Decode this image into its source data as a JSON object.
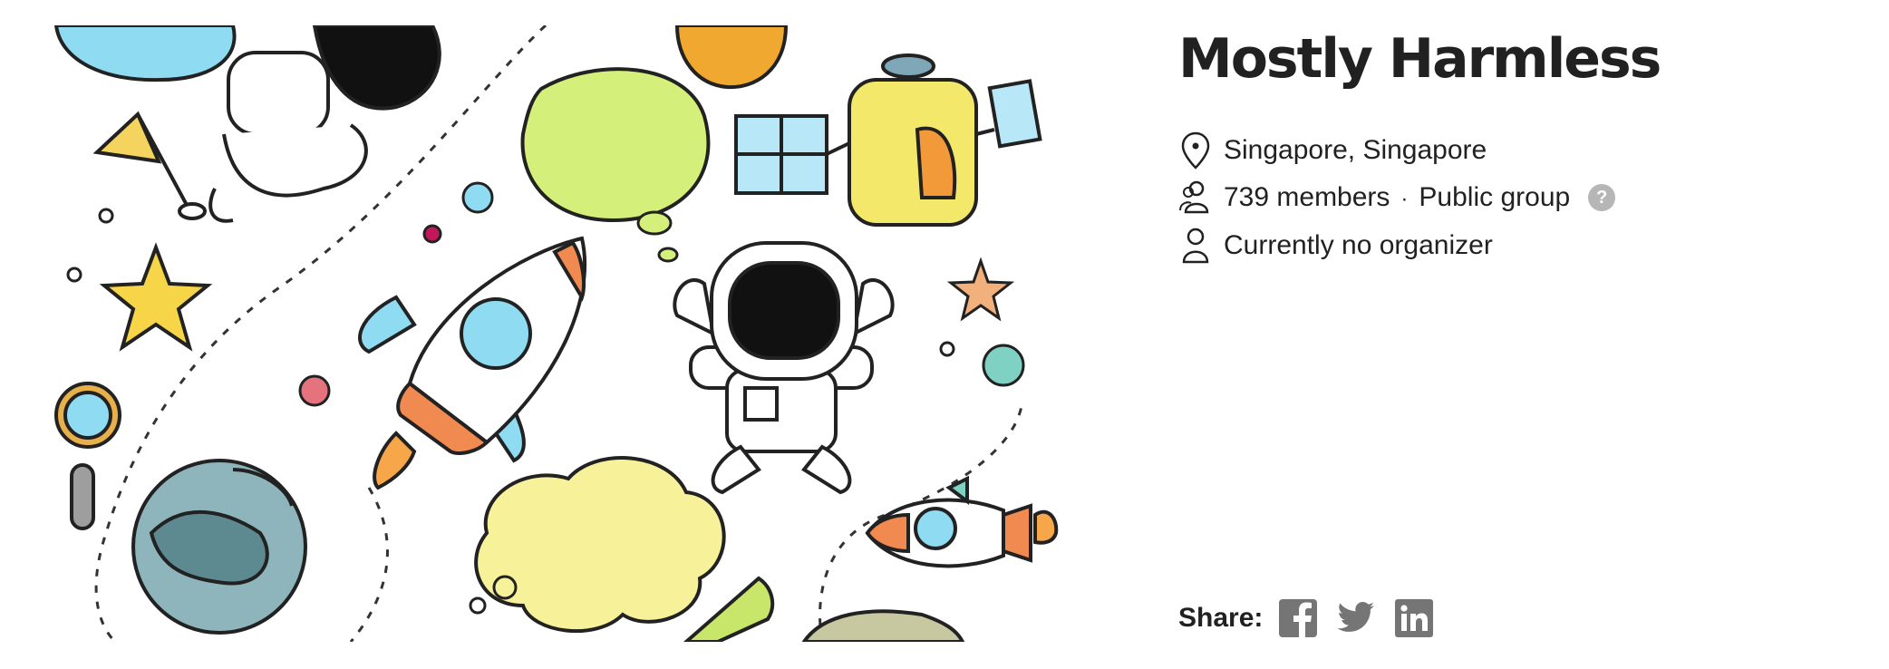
{
  "group": {
    "name": "Mostly Harmless",
    "location": "Singapore, Singapore",
    "members": "739 members",
    "privacy": "Public group",
    "organizer": "Currently no organizer",
    "help_glyph": "?"
  },
  "share": {
    "label": "Share:",
    "networks": [
      "facebook-icon",
      "twitter-icon",
      "linkedin-icon"
    ]
  },
  "hero_image": {
    "subject": "space doodles illustration",
    "icons": [
      "astronaut",
      "rocket",
      "planet",
      "star",
      "satellite",
      "cloud",
      "magnifier",
      "flag"
    ]
  },
  "colors": {
    "text": "#212121",
    "icon_gray": "#757575",
    "help_badge": "#b6b6b6"
  }
}
